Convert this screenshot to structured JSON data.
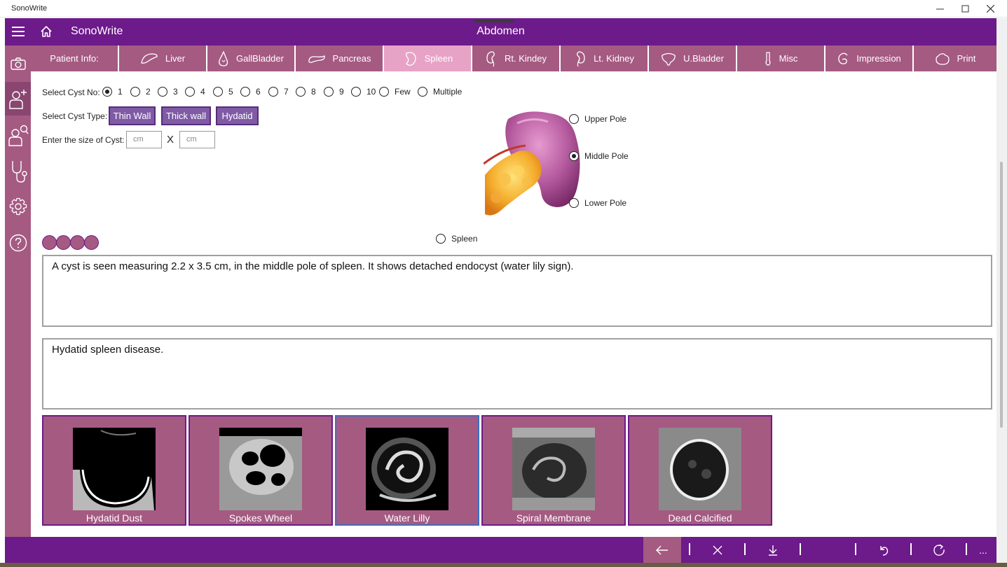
{
  "window": {
    "title": "SonoWrite"
  },
  "header": {
    "app_title": "SonoWrite",
    "section_title": "Abdomen"
  },
  "sidebar": {
    "items": [
      {
        "icon": "camera-icon"
      },
      {
        "icon": "add-patient-icon",
        "active": true
      },
      {
        "icon": "search-patient-icon"
      },
      {
        "icon": "stethoscope-icon"
      },
      {
        "icon": "gear-icon"
      },
      {
        "icon": "help-icon"
      }
    ]
  },
  "tabs": [
    {
      "label": "Patient Info:",
      "icon": ""
    },
    {
      "label": "Liver",
      "icon": "liver-icon"
    },
    {
      "label": "GallBladder",
      "icon": "gallbladder-icon"
    },
    {
      "label": "Pancreas",
      "icon": "pancreas-icon"
    },
    {
      "label": "Spleen",
      "icon": "spleen-icon",
      "active": true
    },
    {
      "label": "Rt. Kindey",
      "icon": "kidney-icon"
    },
    {
      "label": "Lt. Kidney",
      "icon": "kidney-icon"
    },
    {
      "label": "U.Bladder",
      "icon": "bladder-icon"
    },
    {
      "label": "Misc",
      "icon": "misc-icon"
    },
    {
      "label": "Impression",
      "icon": "impression-icon"
    },
    {
      "label": "Print",
      "icon": "print-icon"
    }
  ],
  "cyst_no": {
    "label": "Select Cyst No:",
    "options": [
      "1",
      "2",
      "3",
      "4",
      "5",
      "6",
      "7",
      "8",
      "9",
      "10",
      "Few",
      "Multiple"
    ],
    "selected": "1"
  },
  "cyst_type": {
    "label": "Select Cyst Type:",
    "options": [
      "Thin Wall",
      "Thick wall",
      "Hydatid"
    ]
  },
  "cyst_size": {
    "label": "Enter the size of Cyst:",
    "placeholder1": "cm",
    "separator": "X",
    "placeholder2": "cm"
  },
  "location": {
    "options": [
      "Upper Pole",
      "Middle Pole",
      "Lower Pole"
    ],
    "selected": "Middle Pole",
    "organ_option": "Spleen"
  },
  "findings_text": "A cyst is seen measuring 2.2 x 3.5 cm, in the middle pole of spleen. It shows detached endocyst (water lily sign).",
  "impression_text": "Hydatid spleen disease.",
  "image_cards": [
    {
      "caption": "Hydatid Dust"
    },
    {
      "caption": "Spokes Wheel"
    },
    {
      "caption": "Water Lilly",
      "active": true
    },
    {
      "caption": "Spiral Membrane"
    },
    {
      "caption": "Dead Calcified"
    }
  ],
  "bottom_bar": {
    "buttons": [
      "back-arrow-icon",
      "close-icon",
      "download-icon",
      "blank",
      "undo-icon",
      "refresh-icon",
      "more-icon"
    ],
    "more_label": "..."
  },
  "colors": {
    "header": "#6d1a8a",
    "tab": "#a55a82",
    "tab_active": "#e7a3c6",
    "type_button": "#7f5ba6"
  }
}
